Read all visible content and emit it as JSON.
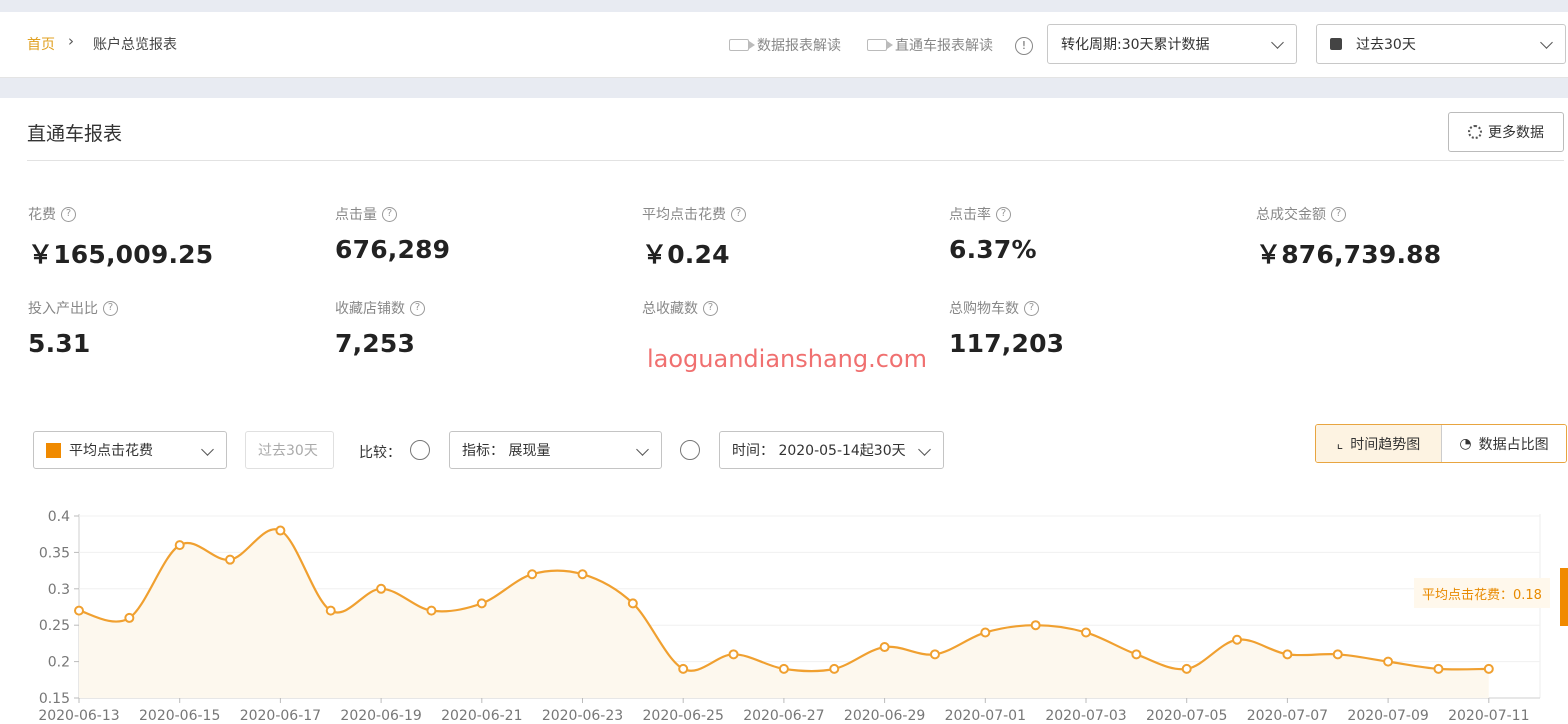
{
  "breadcrumb": {
    "home": "首页",
    "separator": "›",
    "current": "账户总览报表"
  },
  "header": {
    "link_data_report": "数据报表解读",
    "link_ztc_report": "直通车报表解读",
    "info_icon": "!",
    "conversion_select": "转化周期:30天累计数据",
    "date_select": "过去30天"
  },
  "section": {
    "title": "直通车报表",
    "more_button": "更多数据"
  },
  "metrics": [
    {
      "label": "花费",
      "value": "￥165,009.25"
    },
    {
      "label": "点击量",
      "value": "676,289"
    },
    {
      "label": "平均点击花费",
      "value": "￥0.24"
    },
    {
      "label": "点击率",
      "value": "6.37%"
    },
    {
      "label": "总成交金额",
      "value": "￥876,739.88"
    },
    {
      "label": "投入产出比",
      "value": "5.31"
    },
    {
      "label": "收藏店铺数",
      "value": "7,253"
    },
    {
      "label": "总收藏数",
      "value": ""
    },
    {
      "label": "总购物车数",
      "value": "117,203"
    }
  ],
  "help_icon": "?",
  "watermark": "laoguandianshang.com",
  "controls": {
    "metric_select": "平均点击花费",
    "period_button": "过去30天",
    "compare_label": "比较：",
    "indicator_select": "指标： 展现量",
    "time_select": "时间： 2020-05-14起30天",
    "view_trend": "时间趋势图",
    "view_ratio": "数据占比图"
  },
  "colors": {
    "accent": "#f08a00",
    "line": "#f0a030",
    "link": "#e0a020"
  },
  "chart_data": {
    "type": "line",
    "title": "",
    "xlabel": "",
    "ylabel": "",
    "ylim": [
      0.15,
      0.4
    ],
    "yticks": [
      "0.4",
      "0.35",
      "0.3",
      "0.25",
      "0.2",
      "0.15"
    ],
    "xtick_labels": [
      "2020-06-13",
      "2020-06-15",
      "2020-06-17",
      "2020-06-19",
      "2020-06-21",
      "2020-06-23",
      "2020-06-25",
      "2020-06-27",
      "2020-06-29",
      "2020-07-01",
      "2020-07-03",
      "2020-07-05",
      "2020-07-07",
      "2020-07-09",
      "2020-07-11"
    ],
    "x": [
      "2020-06-13",
      "2020-06-14",
      "2020-06-15",
      "2020-06-16",
      "2020-06-17",
      "2020-06-18",
      "2020-06-19",
      "2020-06-20",
      "2020-06-21",
      "2020-06-22",
      "2020-06-23",
      "2020-06-24",
      "2020-06-25",
      "2020-06-26",
      "2020-06-27",
      "2020-06-28",
      "2020-06-29",
      "2020-06-30",
      "2020-07-01",
      "2020-07-02",
      "2020-07-03",
      "2020-07-04",
      "2020-07-05",
      "2020-07-06",
      "2020-07-07",
      "2020-07-08",
      "2020-07-09",
      "2020-07-10",
      "2020-07-11"
    ],
    "series": [
      {
        "name": "平均点击花费",
        "values": [
          0.27,
          0.26,
          0.36,
          0.34,
          0.38,
          0.27,
          0.3,
          0.27,
          0.28,
          0.32,
          0.32,
          0.28,
          0.19,
          0.21,
          0.19,
          0.19,
          0.22,
          0.21,
          0.24,
          0.25,
          0.24,
          0.21,
          0.19,
          0.23,
          0.21,
          0.21,
          0.2,
          0.19,
          0.19
        ]
      }
    ],
    "grid": true,
    "tooltip": "平均点击花费：0.18"
  }
}
